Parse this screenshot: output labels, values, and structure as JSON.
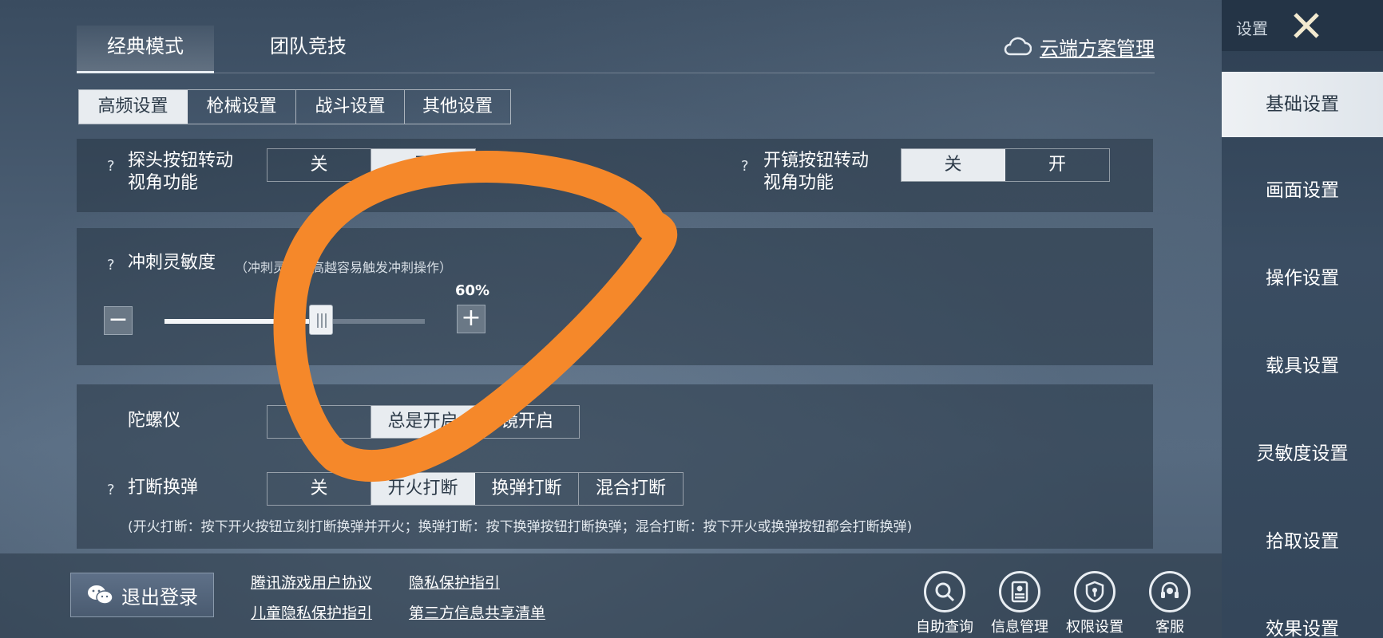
{
  "colors": {
    "accent_selected_bg": "#e8ecf0",
    "annotation_orange": "#f5882a",
    "sidebar_bg": "#34465a"
  },
  "mode_tabs": [
    {
      "label": "经典模式",
      "active": true
    },
    {
      "label": "团队竞技",
      "active": false
    }
  ],
  "cloud": {
    "label": "云端方案管理",
    "icon": "cloud-icon"
  },
  "sub_tabs": [
    {
      "label": "高频设置",
      "active": true
    },
    {
      "label": "枪械设置",
      "active": false
    },
    {
      "label": "战斗设置",
      "active": false
    },
    {
      "label": "其他设置",
      "active": false
    }
  ],
  "peek_turn": {
    "q": "?",
    "label_line1": "探头按钮转动",
    "label_line2": "视角功能",
    "options": [
      "关",
      "开"
    ],
    "selected": "开"
  },
  "scope_turn": {
    "q": "?",
    "label_line1": "开镜按钮转动",
    "label_line2": "视角功能",
    "options": [
      "关",
      "开"
    ],
    "selected": "关"
  },
  "sprint": {
    "q": "?",
    "label": "冲刺灵敏度",
    "hint": "（冲刺灵…越高越容易触发冲刺操作）",
    "value_text": "60%",
    "value": 0.6,
    "minus": "−",
    "plus": "+"
  },
  "gyro": {
    "label": "陀螺仪",
    "options": [
      "",
      "总是开启",
      "镜开启"
    ],
    "selected": "总是开启"
  },
  "interrupt": {
    "q": "?",
    "label": "打断换弹",
    "options": [
      "关",
      "开火打断",
      "换弹打断",
      "混合打断"
    ],
    "selected": "开火打断",
    "note": "(开火打断：按下开火按钮立刻打断换弹并开火；换弹打断：按下换弹按钮打断换弹；混合打断：按下开火或换弹按钮都会打断换弹)"
  },
  "bottom": {
    "logout": {
      "label": "退出登录",
      "icon": "wechat-icon"
    },
    "links": [
      "腾讯游戏用户协议",
      "隐私保护指引",
      "儿童隐私保护指引",
      "第三方信息共享清单"
    ],
    "icons": [
      {
        "label": "自助查询",
        "icon": "search-icon"
      },
      {
        "label": "信息管理",
        "icon": "id-card-icon"
      },
      {
        "label": "权限设置",
        "icon": "shield-icon"
      },
      {
        "label": "客服",
        "icon": "headset-icon"
      }
    ]
  },
  "sidebar": {
    "title": "设置",
    "close_icon": "close-icon",
    "items": [
      {
        "label": "基础设置",
        "active": true
      },
      {
        "label": "画面设置",
        "active": false
      },
      {
        "label": "操作设置",
        "active": false
      },
      {
        "label": "载具设置",
        "active": false
      },
      {
        "label": "灵敏度设置",
        "active": false
      },
      {
        "label": "拾取设置",
        "active": false
      },
      {
        "label": "效果设置",
        "active": false
      }
    ]
  }
}
